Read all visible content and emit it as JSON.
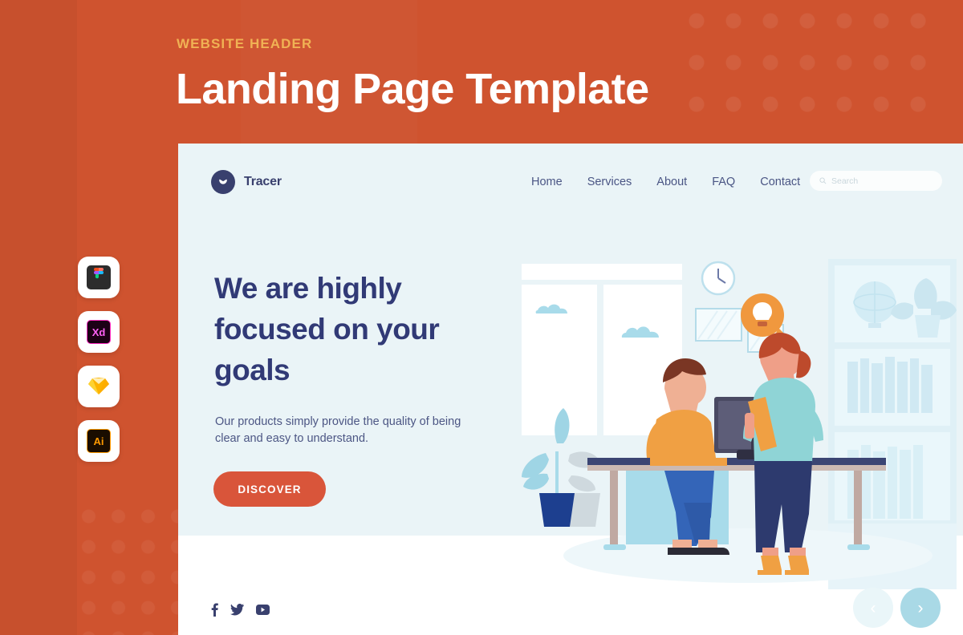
{
  "poster": {
    "kicker": "WEBSITE HEADER",
    "title": "Landing Page Template",
    "bg_color": "#cf532f",
    "kicker_color": "#f0b254"
  },
  "tool_rail": {
    "items": [
      {
        "name": "figma",
        "label": ""
      },
      {
        "name": "adobe-xd",
        "label": "Xd"
      },
      {
        "name": "sketch",
        "label": ""
      },
      {
        "name": "adobe-illustrator",
        "label": "Ai"
      }
    ]
  },
  "site": {
    "brand": {
      "name": "Tracer",
      "color": "#39406e",
      "icon": "tulip-logo-icon"
    },
    "nav": [
      {
        "label": "Home"
      },
      {
        "label": "Services"
      },
      {
        "label": "About"
      },
      {
        "label": "FAQ"
      },
      {
        "label": "Contact"
      }
    ],
    "search": {
      "placeholder": "Search",
      "value": "",
      "icon": "search-icon"
    },
    "hero": {
      "heading": "We are highly focused on your goals",
      "subheading": "Our products simply provide the quality of being clear and easy to understand.",
      "cta_label": "DISCOVER",
      "cta_color": "#d9553a",
      "heading_color": "#313a76",
      "bg_color": "#eaf4f7"
    },
    "illustration": {
      "name": "office-teamwork-illustration",
      "elements": [
        "window-with-clouds",
        "wall-clock",
        "picture-frames",
        "idea-speech-bubble-lightbulb",
        "seated-man-at-monitor",
        "standing-woman-with-folder",
        "desk",
        "potted-plant",
        "bookshelf-with-globe-and-plant"
      ]
    },
    "social": [
      {
        "name": "facebook",
        "glyph": "f"
      },
      {
        "name": "twitter",
        "glyph": "t"
      },
      {
        "name": "youtube",
        "glyph": "y"
      }
    ],
    "carousel": {
      "prev_label": "‹",
      "next_label": "›",
      "prev_color": "#eaf6f9",
      "next_color": "#a9d9e6"
    }
  }
}
